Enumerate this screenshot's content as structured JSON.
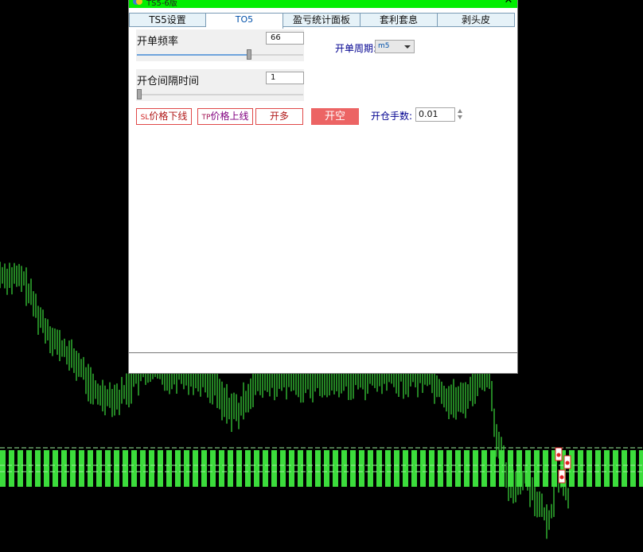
{
  "window": {
    "title": "TS5-6版",
    "close_glyph": "✕"
  },
  "tabs": [
    {
      "label": "TS5设置"
    },
    {
      "label": "TO5"
    },
    {
      "label": "盈亏统计面板"
    },
    {
      "label": "套利套息"
    },
    {
      "label": "剥头皮"
    }
  ],
  "active_tab": 1,
  "panel": {
    "open_frequency": {
      "label": "开单频率",
      "value": "66",
      "level": 0.68
    },
    "open_interval": {
      "label": "开仓间隔时间",
      "value": "1",
      "level": 0.0
    },
    "period": {
      "label": "开单周期:",
      "selected": "m5"
    },
    "lots": {
      "label": "开仓手数:",
      "value": "0.01"
    },
    "buttons": {
      "sl_prefix": "SL",
      "sl_text": "价格下线",
      "tp_prefix": "TP",
      "tp_text": "价格上线",
      "buy": "开多",
      "sell": "开空"
    }
  },
  "colors": {
    "titlebar": "#00ee00",
    "accent_red": "#ec6464",
    "candle_green": "#3cdc3c",
    "label_blue": "#000090"
  },
  "icons": [
    "app-icon",
    "close-icon",
    "chevron-down-icon",
    "spinner-up-icon",
    "spinner-down-icon"
  ]
}
